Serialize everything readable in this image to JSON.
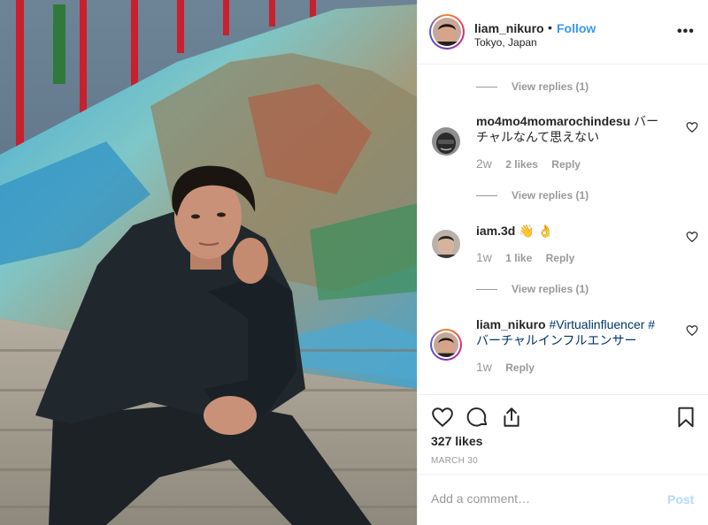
{
  "header": {
    "username": "liam_nikuro",
    "separator": "•",
    "follow_label": "Follow",
    "location": "Tokyo, Japan",
    "more_label": "•••"
  },
  "comments": [
    {
      "view_replies": "View replies (1)"
    },
    {
      "username": "mo4mo4momarochindesu",
      "text": "バーチャルなんて思えない",
      "time": "2w",
      "likes": "2 likes",
      "reply_label": "Reply",
      "view_replies": "View replies (1)"
    },
    {
      "username": "iam.3d",
      "text": "👋 👌",
      "time": "1w",
      "likes": "1 like",
      "reply_label": "Reply",
      "view_replies": "View replies (1)"
    },
    {
      "username": "liam_nikuro",
      "tag1": "#Virtualinfluencer",
      "tag2": "#",
      "tag3": "バーチャルインフルエンサー",
      "time": "1w",
      "reply_label": "Reply"
    }
  ],
  "post": {
    "likes": "327 likes",
    "date": "MARCH 30",
    "comment_placeholder": "Add a comment…",
    "post_label": "Post"
  },
  "colors": {
    "accent": "#3897f0",
    "hashtag": "#003569",
    "muted": "#999999",
    "post_disabled": "#b3dbff"
  },
  "icons": [
    "heart-icon",
    "comment-icon",
    "share-icon",
    "bookmark-icon",
    "more-icon"
  ]
}
